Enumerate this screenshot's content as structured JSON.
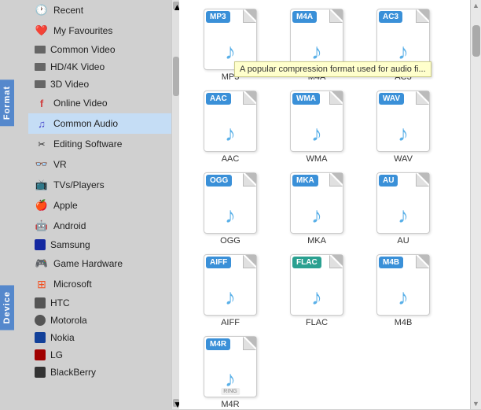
{
  "sidebar": {
    "format_tab": "Format",
    "device_tab": "Device",
    "items": [
      {
        "id": "recent",
        "label": "Recent",
        "icon": "🕐",
        "color": "#888"
      },
      {
        "id": "my-favourites",
        "label": "My Favourites",
        "icon": "❤️",
        "color": "#e04040"
      },
      {
        "id": "common-video",
        "label": "Common Video",
        "icon": "🎬",
        "color": "#444"
      },
      {
        "id": "hd-4k-video",
        "label": "HD/4K Video",
        "icon": "🎬",
        "color": "#444"
      },
      {
        "id": "3d-video",
        "label": "3D Video",
        "icon": "🎬",
        "color": "#444"
      },
      {
        "id": "online-video",
        "label": "Online Video",
        "icon": "f",
        "color": "#d04040"
      },
      {
        "id": "common-audio",
        "label": "Common Audio",
        "icon": "♫",
        "color": "#4444cc"
      },
      {
        "id": "editing-software",
        "label": "Editing Software",
        "icon": "✂",
        "color": "#888"
      },
      {
        "id": "vr",
        "label": "VR",
        "icon": "👓",
        "color": "#444"
      },
      {
        "id": "tvs-players",
        "label": "TVs/Players",
        "icon": "📺",
        "color": "#444"
      },
      {
        "id": "apple",
        "label": "Apple",
        "icon": "🍎",
        "color": "#888"
      },
      {
        "id": "android",
        "label": "Android",
        "icon": "🤖",
        "color": "#80b020"
      },
      {
        "id": "samsung",
        "label": "Samsung",
        "icon": "⬛",
        "color": "#1428a0"
      },
      {
        "id": "game-hardware",
        "label": "Game Hardware",
        "icon": "🎮",
        "color": "#444"
      },
      {
        "id": "microsoft",
        "label": "Microsoft",
        "icon": "⊞",
        "color": "#f35020"
      },
      {
        "id": "htc",
        "label": "HTC",
        "icon": "⬛",
        "color": "#444"
      },
      {
        "id": "motorola",
        "label": "Motorola",
        "icon": "M",
        "color": "#444"
      },
      {
        "id": "nokia",
        "label": "Nokia",
        "icon": "N",
        "color": "#124099"
      },
      {
        "id": "lg",
        "label": "LG",
        "icon": "⬛",
        "color": "#a00000"
      },
      {
        "id": "blackberry",
        "label": "BlackBerry",
        "icon": "B",
        "color": "#444"
      }
    ]
  },
  "formats": [
    {
      "id": "mp3",
      "label": "MP3",
      "badge_color": "#3a90d8"
    },
    {
      "id": "m4a",
      "label": "M4A",
      "badge_color": "#3a90d8"
    },
    {
      "id": "ac3",
      "label": "AC3",
      "badge_color": "#3a90d8"
    },
    {
      "id": "aac",
      "label": "AAC",
      "badge_color": "#3a90d8"
    },
    {
      "id": "wma",
      "label": "WMA",
      "badge_color": "#3a90d8"
    },
    {
      "id": "wav",
      "label": "WAV",
      "badge_color": "#3a90d8"
    },
    {
      "id": "ogg",
      "label": "OGG",
      "badge_color": "#3a90d8"
    },
    {
      "id": "mka",
      "label": "MKA",
      "badge_color": "#3a90d8"
    },
    {
      "id": "au",
      "label": "AU",
      "badge_color": "#3a90d8"
    },
    {
      "id": "aiff",
      "label": "AIFF",
      "badge_color": "#3a90d8"
    },
    {
      "id": "flac",
      "label": "FLAC",
      "badge_color": "#2aa090"
    },
    {
      "id": "m4b",
      "label": "M4B",
      "badge_color": "#3a90d8"
    },
    {
      "id": "m4r",
      "label": "M4R",
      "badge_color": "#3a90d8"
    }
  ],
  "tooltip": {
    "text": "A popular compression format used for audio fi..."
  },
  "colors": {
    "badge_mp3": "#3a90d8",
    "badge_flac": "#2aa090",
    "sidebar_bg": "#f0f0f0",
    "tab_bg": "#5588cc"
  }
}
